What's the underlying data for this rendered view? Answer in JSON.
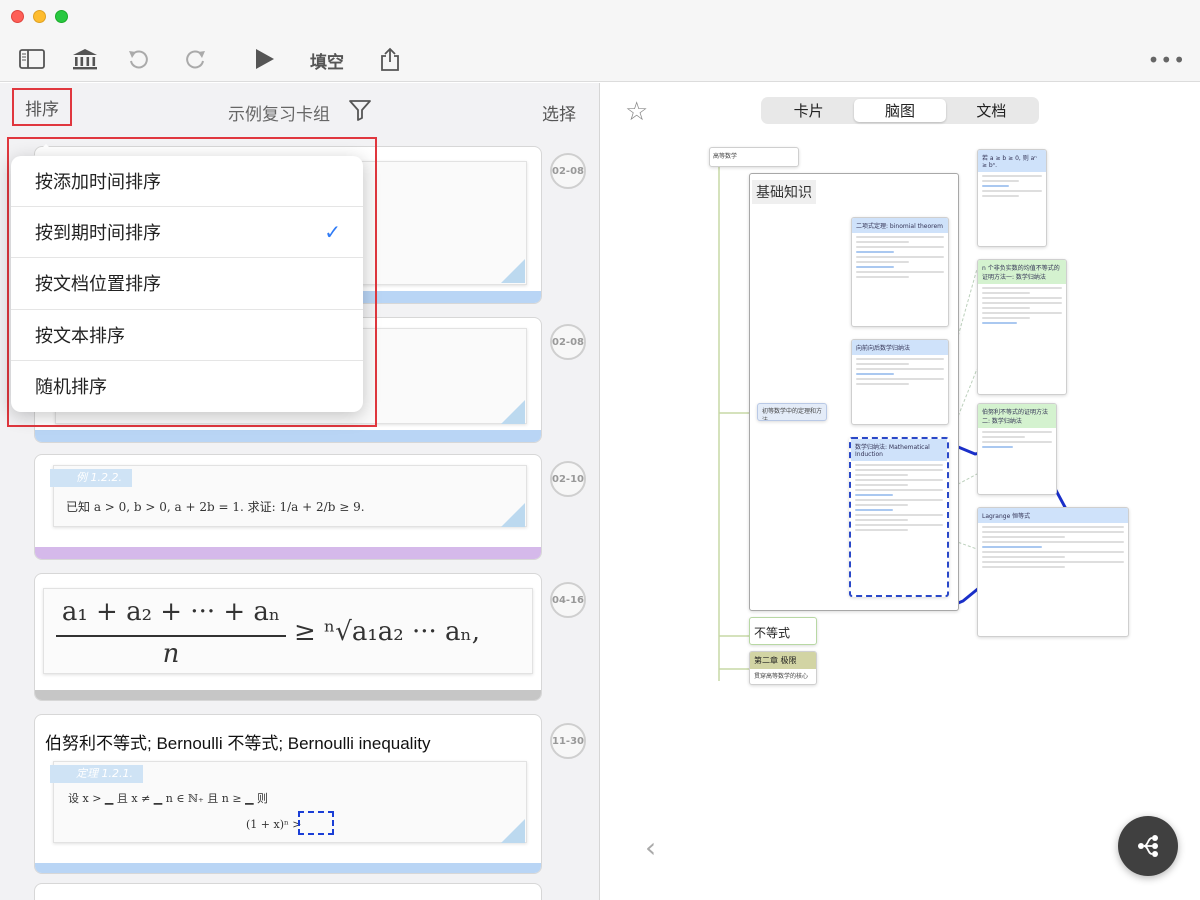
{
  "toolbar": {
    "fill_label": "填空",
    "icons": [
      "sidebar-icon",
      "library-icon",
      "undo-icon",
      "redo-icon",
      "play-icon",
      "share-icon",
      "more-icon"
    ]
  },
  "left_panel": {
    "sort_label": "排序",
    "deck_title": "示例复习卡组",
    "select_label": "选择"
  },
  "sort_menu": {
    "items": [
      {
        "label": "按添加时间排序",
        "checked": false
      },
      {
        "label": "按到期时间排序",
        "checked": true
      },
      {
        "label": "按文档位置排序",
        "checked": false
      },
      {
        "label": "按文本排序",
        "checked": false
      },
      {
        "label": "随机排序",
        "checked": false
      }
    ],
    "check_mark": "✓"
  },
  "cards": [
    {
      "date": "02-08",
      "strip_color": "#b9d5f5"
    },
    {
      "date": "02-08",
      "strip_color": "#b9d5f5"
    },
    {
      "date": "02-10",
      "strip_color": "#d5b9ea",
      "tag": "例 1.2.2.",
      "content": "已知 a > 0, b > 0, a + 2b = 1. 求证: 1/a + 2/b ≥ 9."
    },
    {
      "date": "04-16",
      "strip_color": "#c6c6c6",
      "formula_lhs_num": "a₁ + a₂ + ··· + aₙ",
      "formula_lhs_den": "n",
      "formula_rhs": "≥  ⁿ√a₁a₂ ··· aₙ,"
    },
    {
      "date": "11-30",
      "strip_color": "#b9d5f5",
      "title": "伯努利不等式; Bernoulli 不等式; Bernoulli inequality",
      "tag": "定理 1.2.1.",
      "line1": "设 x > ▁ 且 x ≠ ▁ n ∈ ℕ₊ 且 n ≥ ▁ 则",
      "line2": "(1 + x)ⁿ >"
    }
  ],
  "right_panel": {
    "tabs": [
      {
        "label": "卡片",
        "active": false
      },
      {
        "label": "脑图",
        "active": true
      },
      {
        "label": "文档",
        "active": false
      }
    ]
  },
  "mindmap": {
    "root": "高等数学",
    "main_node": "基础知识",
    "side_node": "初等数学中的定理和方法",
    "node_binomial": "二项式定理: binomial theorem",
    "node_induction_dir": "向前向后数学归纳法",
    "node_induction": "数学归纳法: Mathematical Induction",
    "node_tr1": "若 a ≥ b ≥ 0, 则 aⁿ ≥ bⁿ.",
    "node_tr2": "n 个非负实数的均值不等式的证明方法一: 数学归纳法",
    "node_tr3": "伯努利不等式的证明方法二: 数学归纳法",
    "node_lagrange": "Lagrange 恒等式",
    "node_ineq": "不等式",
    "node_ch2": "第二章 极限",
    "node_ch2_sub": "贯穿高等数学的核心"
  }
}
